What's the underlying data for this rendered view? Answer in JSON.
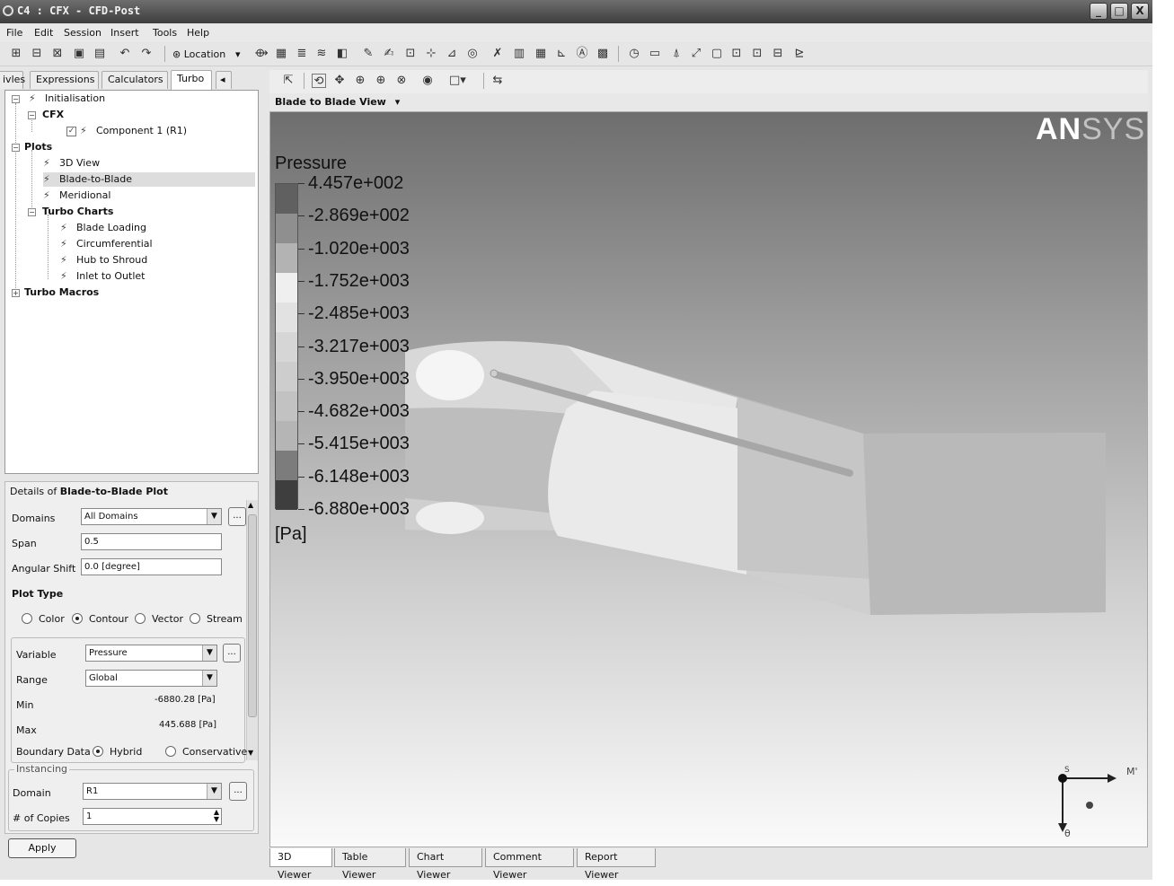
{
  "window": {
    "title": "C4 : CFX - CFD-Post",
    "buttons": [
      "_",
      "□",
      "X"
    ]
  },
  "menu": [
    "File",
    "Edit",
    "Session",
    "Insert",
    "Tools",
    "Help"
  ],
  "toolbar": {
    "location_label": "Location",
    "location_arrow": "▾"
  },
  "left_tabs": [
    "ivles",
    "Expressions",
    "Calculators",
    "Turbo"
  ],
  "tree": {
    "initialisation": "Initialisation",
    "cfx": "CFX",
    "component": "Component 1 (R1)",
    "plots": "Plots",
    "view_3d": "3D View",
    "blade_to_blade": "Blade-to-Blade",
    "meridional": "Meridional",
    "turbo_charts": "Turbo Charts",
    "blade_loading": "Blade Loading",
    "circumferential": "Circumferential",
    "hub_to_shroud": "Hub to Shroud",
    "inlet_to_outlet": "Inlet to Outlet",
    "turbo_macros": "Turbo Macros"
  },
  "details": {
    "heading_prefix": "Details of ",
    "heading_bold": "Blade-to-Blade Plot",
    "domains_label": "Domains",
    "domains_value": "All Domains",
    "span_label": "Span",
    "span_value": "0.5",
    "angular_label": "Angular Shift",
    "angular_value": "0.0 [degree]",
    "plot_type_label": "Plot Type",
    "plot_types": [
      "Color",
      "Contour",
      "Vector",
      "Stream"
    ],
    "plot_type_selected": "Contour",
    "variable_label": "Variable",
    "variable_value": "Pressure",
    "range_label": "Range",
    "range_value": "Global",
    "min_label": "Min",
    "min_value": "-6880.28 [Pa]",
    "max_label": "Max",
    "max_value": "445.688 [Pa]",
    "boundary_label": "Boundary Data",
    "boundary_hybrid": "Hybrid",
    "boundary_conservative": "Conservative",
    "instancing_label": "Instancing",
    "domain_label": "Domain",
    "domain_value": "R1",
    "copies_label": "# of Copies",
    "copies_value": "1",
    "ellipsis": "...",
    "apply": "Apply"
  },
  "viewer": {
    "view_title": "Blade to Blade View",
    "view_arrow": "▾",
    "logo_bold": "AN",
    "logo_light": "SYS",
    "legend_title": "Pressure",
    "legend_labels": [
      "4.457e+002",
      "-2.869e+002",
      "-1.020e+003",
      "-1.752e+003",
      "-2.485e+003",
      "-3.217e+003",
      "-3.950e+003",
      "-4.682e+003",
      "-5.415e+003",
      "-6.148e+003",
      "-6.880e+003"
    ],
    "legend_unit": "[Pa]",
    "legend_colors": [
      "#606060",
      "#8f8f8f",
      "#b3b3b3",
      "#efefef",
      "#e2e2e2",
      "#d6d6d6",
      "#cdcdcd",
      "#c2c2c2",
      "#b5b5b5",
      "#7c7c7c",
      "#3e3e3e"
    ],
    "axis_m": "M'",
    "axis_theta": "θ",
    "axis_s": "S"
  },
  "bottom_tabs": [
    "3D Viewer",
    "Table Viewer",
    "Chart Viewer",
    "Comment Viewer",
    "Report Viewer"
  ]
}
